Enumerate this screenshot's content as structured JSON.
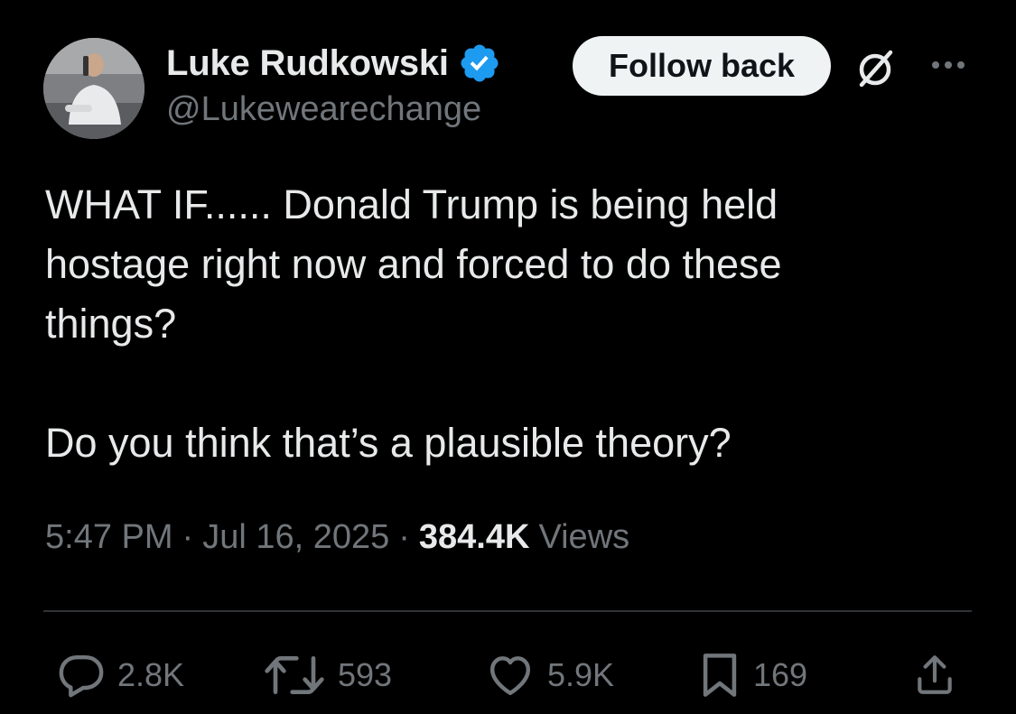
{
  "author": {
    "display_name": "Luke Rudkowski",
    "handle": "@Lukewearechange",
    "verified": true,
    "verified_color": "#1d9bf0"
  },
  "header": {
    "follow_label": "Follow back",
    "grok_icon": "grok-icon",
    "more_icon": "more-icon"
  },
  "tweet": {
    "paragraph_1": "WHAT IF...... Donald Trump is being held hostage right now and forced to do these things?",
    "paragraph_2": "Do you think that’s a plausible theory?"
  },
  "meta": {
    "time": "5:47 PM",
    "separator": "·",
    "date": "Jul 16, 2025",
    "views_count": "384.4K",
    "views_label": "Views"
  },
  "actions": {
    "replies": "2.8K",
    "reposts": "593",
    "likes": "5.9K",
    "bookmarks": "169"
  },
  "colors": {
    "background": "#000000",
    "text_primary": "#e7e9ea",
    "text_secondary": "#71767b",
    "divider": "#2f3336",
    "button_bg": "#eff3f4"
  }
}
